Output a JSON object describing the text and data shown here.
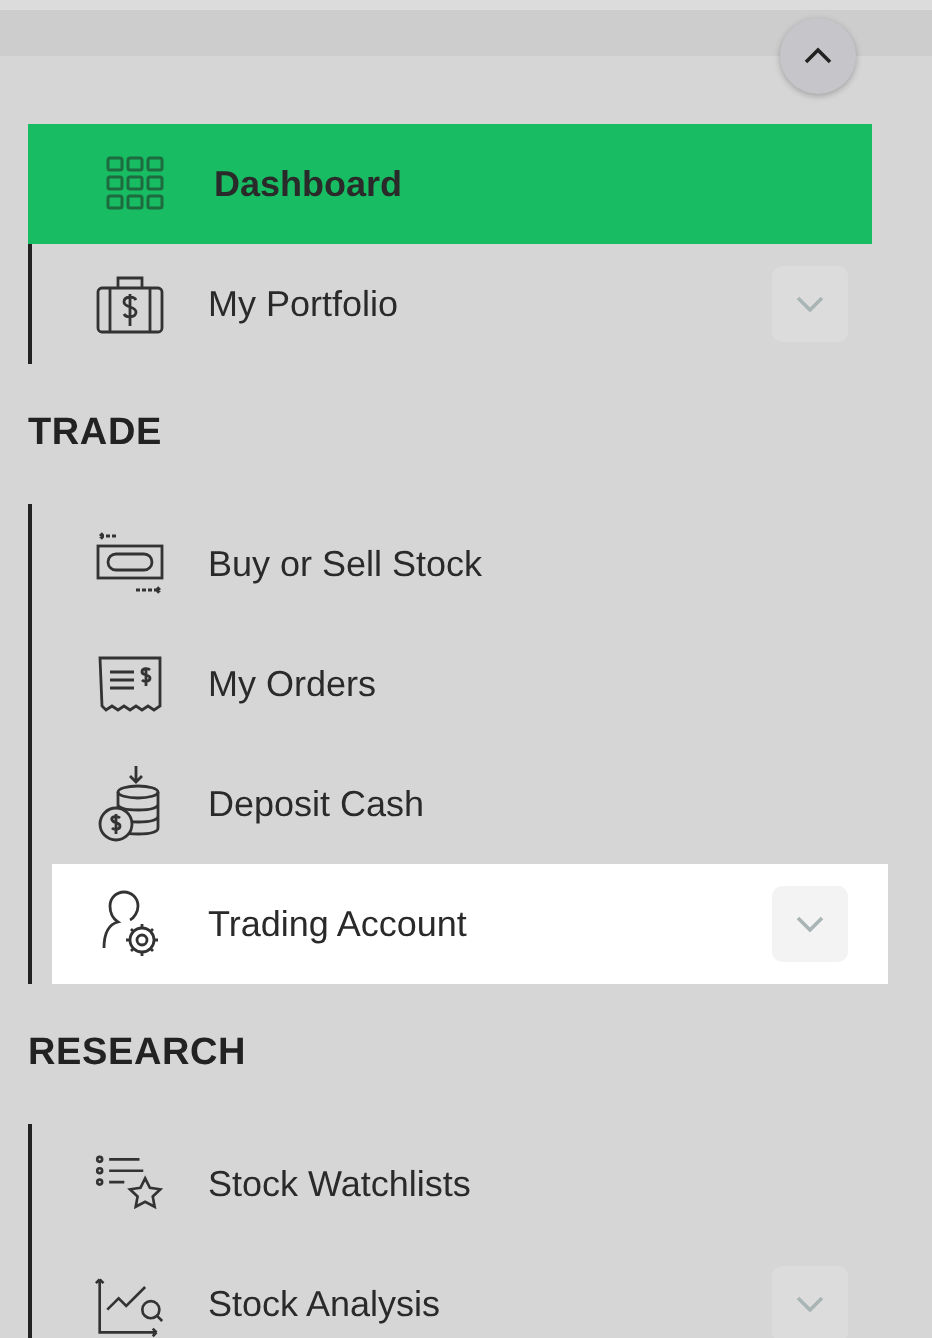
{
  "sections": [
    {
      "items": [
        {
          "label": "Dashboard",
          "selected": true,
          "highlighted": false,
          "expandable": false
        },
        {
          "label": "My Portfolio",
          "selected": false,
          "highlighted": false,
          "expandable": true
        }
      ]
    },
    {
      "heading": "TRADE",
      "items": [
        {
          "label": "Buy or Sell Stock",
          "selected": false,
          "highlighted": false,
          "expandable": false
        },
        {
          "label": "My Orders",
          "selected": false,
          "highlighted": false,
          "expandable": false
        },
        {
          "label": "Deposit Cash",
          "selected": false,
          "highlighted": false,
          "expandable": false
        },
        {
          "label": "Trading Account",
          "selected": false,
          "highlighted": true,
          "expandable": true
        }
      ]
    },
    {
      "heading": "RESEARCH",
      "items": [
        {
          "label": "Stock Watchlists",
          "selected": false,
          "highlighted": false,
          "expandable": false
        },
        {
          "label": "Stock Analysis",
          "selected": false,
          "highlighted": false,
          "expandable": true
        }
      ]
    }
  ]
}
